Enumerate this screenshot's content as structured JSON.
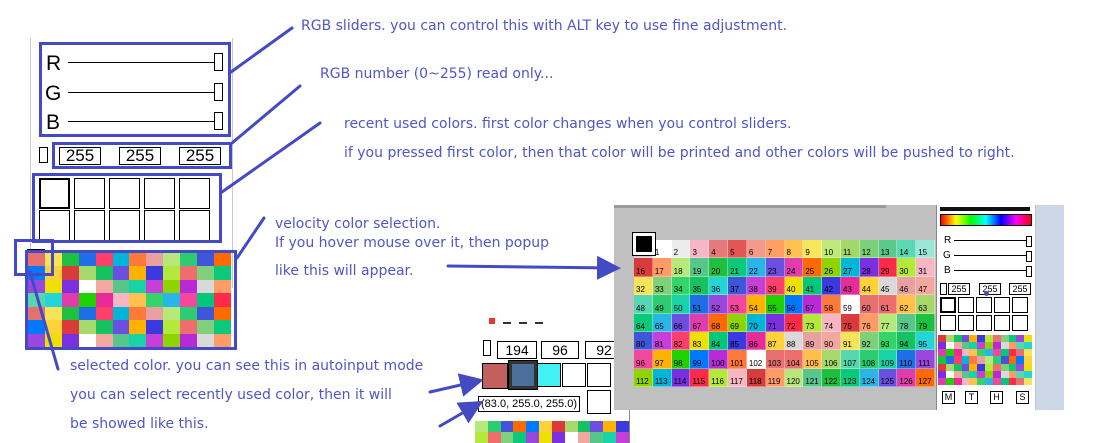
{
  "annotations": {
    "rgb_sliders": "RGB sliders. you can control this with ALT key to use fine adjustment.",
    "rgb_number": "RGB number (0~255) read only...",
    "recent_line1": "recent used colors. first color changes when you control sliders.",
    "recent_line2": "if you pressed first color, then that color will be printed and other colors will be pushed to right.",
    "velocity_line1": "velocity color selection.",
    "velocity_line2": "If you hover mouse over it, then popup",
    "velocity_line3": "like this will appear.",
    "selected_line1": "selected color. you can see this in autoinput mode",
    "selected_line2": "you can select recently used color, then it will",
    "selected_line3": "be showed like this."
  },
  "left_panel": {
    "sliders": [
      {
        "label": "R"
      },
      {
        "label": "G"
      },
      {
        "label": "B"
      }
    ],
    "rgb_values": [
      "255",
      "255",
      "255"
    ]
  },
  "autoinput_panel": {
    "rgb_values": [
      "194",
      "96",
      "92"
    ],
    "tooltip": "(83.0, 255.0, 255.0)",
    "recent_colors": [
      "#c1605c",
      "#4a6f9a",
      "#42f0f5"
    ]
  },
  "popup_panel": {
    "numbers": [
      "1",
      "2",
      "3",
      "4",
      "5",
      "6",
      "7",
      "8",
      "9",
      "10",
      "11",
      "12",
      "13",
      "14",
      "15",
      "16",
      "17",
      "18",
      "19",
      "20",
      "21",
      "22",
      "23",
      "24",
      "25",
      "26",
      "27",
      "28",
      "29",
      "30",
      "31",
      "32",
      "33",
      "34",
      "35",
      "36",
      "37",
      "38",
      "39",
      "40",
      "41",
      "42",
      "43",
      "44",
      "45",
      "46",
      "47",
      "48",
      "49",
      "50",
      "51",
      "52",
      "53",
      "54",
      "55",
      "56",
      "57",
      "58",
      "59",
      "60",
      "61",
      "62",
      "63",
      "64",
      "65",
      "66",
      "67",
      "68",
      "69",
      "70",
      "71",
      "72",
      "73",
      "74",
      "75",
      "76",
      "77",
      "78",
      "79",
      "80",
      "81",
      "82",
      "83",
      "84",
      "85",
      "86",
      "87",
      "88",
      "89",
      "90",
      "91",
      "92",
      "93",
      "94",
      "95",
      "96",
      "97",
      "98",
      "99",
      "100",
      "101",
      "102",
      "103",
      "104",
      "105",
      "106",
      "107",
      "108",
      "109",
      "110",
      "111",
      "112",
      "113",
      "114",
      "115",
      "116",
      "117",
      "118",
      "119",
      "120",
      "121",
      "122",
      "123",
      "124",
      "125",
      "126",
      "127"
    ],
    "slider_labels": [
      "R",
      "G",
      "B"
    ],
    "rgb_values": [
      "255",
      "255",
      "255"
    ],
    "mode_buttons": [
      "M",
      "T",
      "H",
      "S"
    ]
  },
  "colors": {
    "annotation": "#4449c4",
    "note_text": "#5055c8"
  }
}
